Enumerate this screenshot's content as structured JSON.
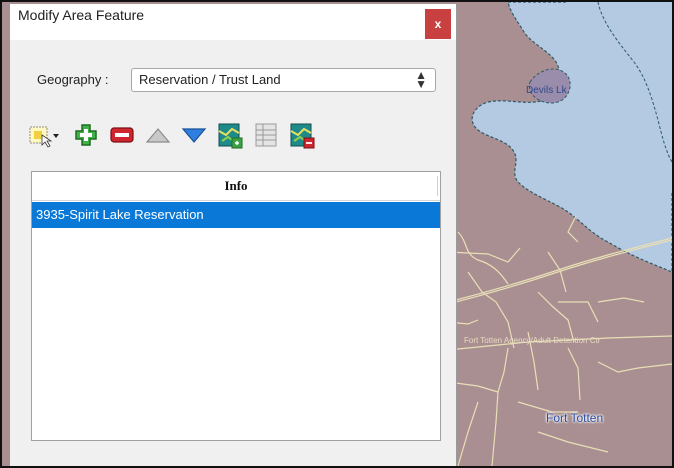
{
  "window": {
    "title": "Modify Area Feature",
    "close_label": "x"
  },
  "geography": {
    "label": "Geography :",
    "selected": "Reservation / Trust Land"
  },
  "toolbar": {
    "buttons": [
      {
        "name": "select-feature-button",
        "icon": "select-rectangle-icon"
      },
      {
        "name": "add-button",
        "icon": "plus-icon"
      },
      {
        "name": "remove-button",
        "icon": "minus-icon"
      },
      {
        "name": "move-up-button",
        "icon": "triangle-up-icon"
      },
      {
        "name": "move-down-button",
        "icon": "triangle-down-icon"
      },
      {
        "name": "add-map-feature-button",
        "icon": "map-add-icon"
      },
      {
        "name": "attribute-table-button",
        "icon": "table-icon"
      },
      {
        "name": "remove-map-feature-button",
        "icon": "map-remove-icon"
      }
    ]
  },
  "info_list": {
    "header": "Info",
    "items": [
      "3935-Spirit Lake Reservation"
    ],
    "selected_index": 0
  },
  "map": {
    "labels": {
      "lake": "Devils Lk",
      "agency": "Fort Totten Agency/Adult Detention Ctr",
      "town": "Fort Totten"
    },
    "colors": {
      "land": "#a98f92",
      "water": "#b4c9e2",
      "roads": "#e8dfb6"
    }
  }
}
